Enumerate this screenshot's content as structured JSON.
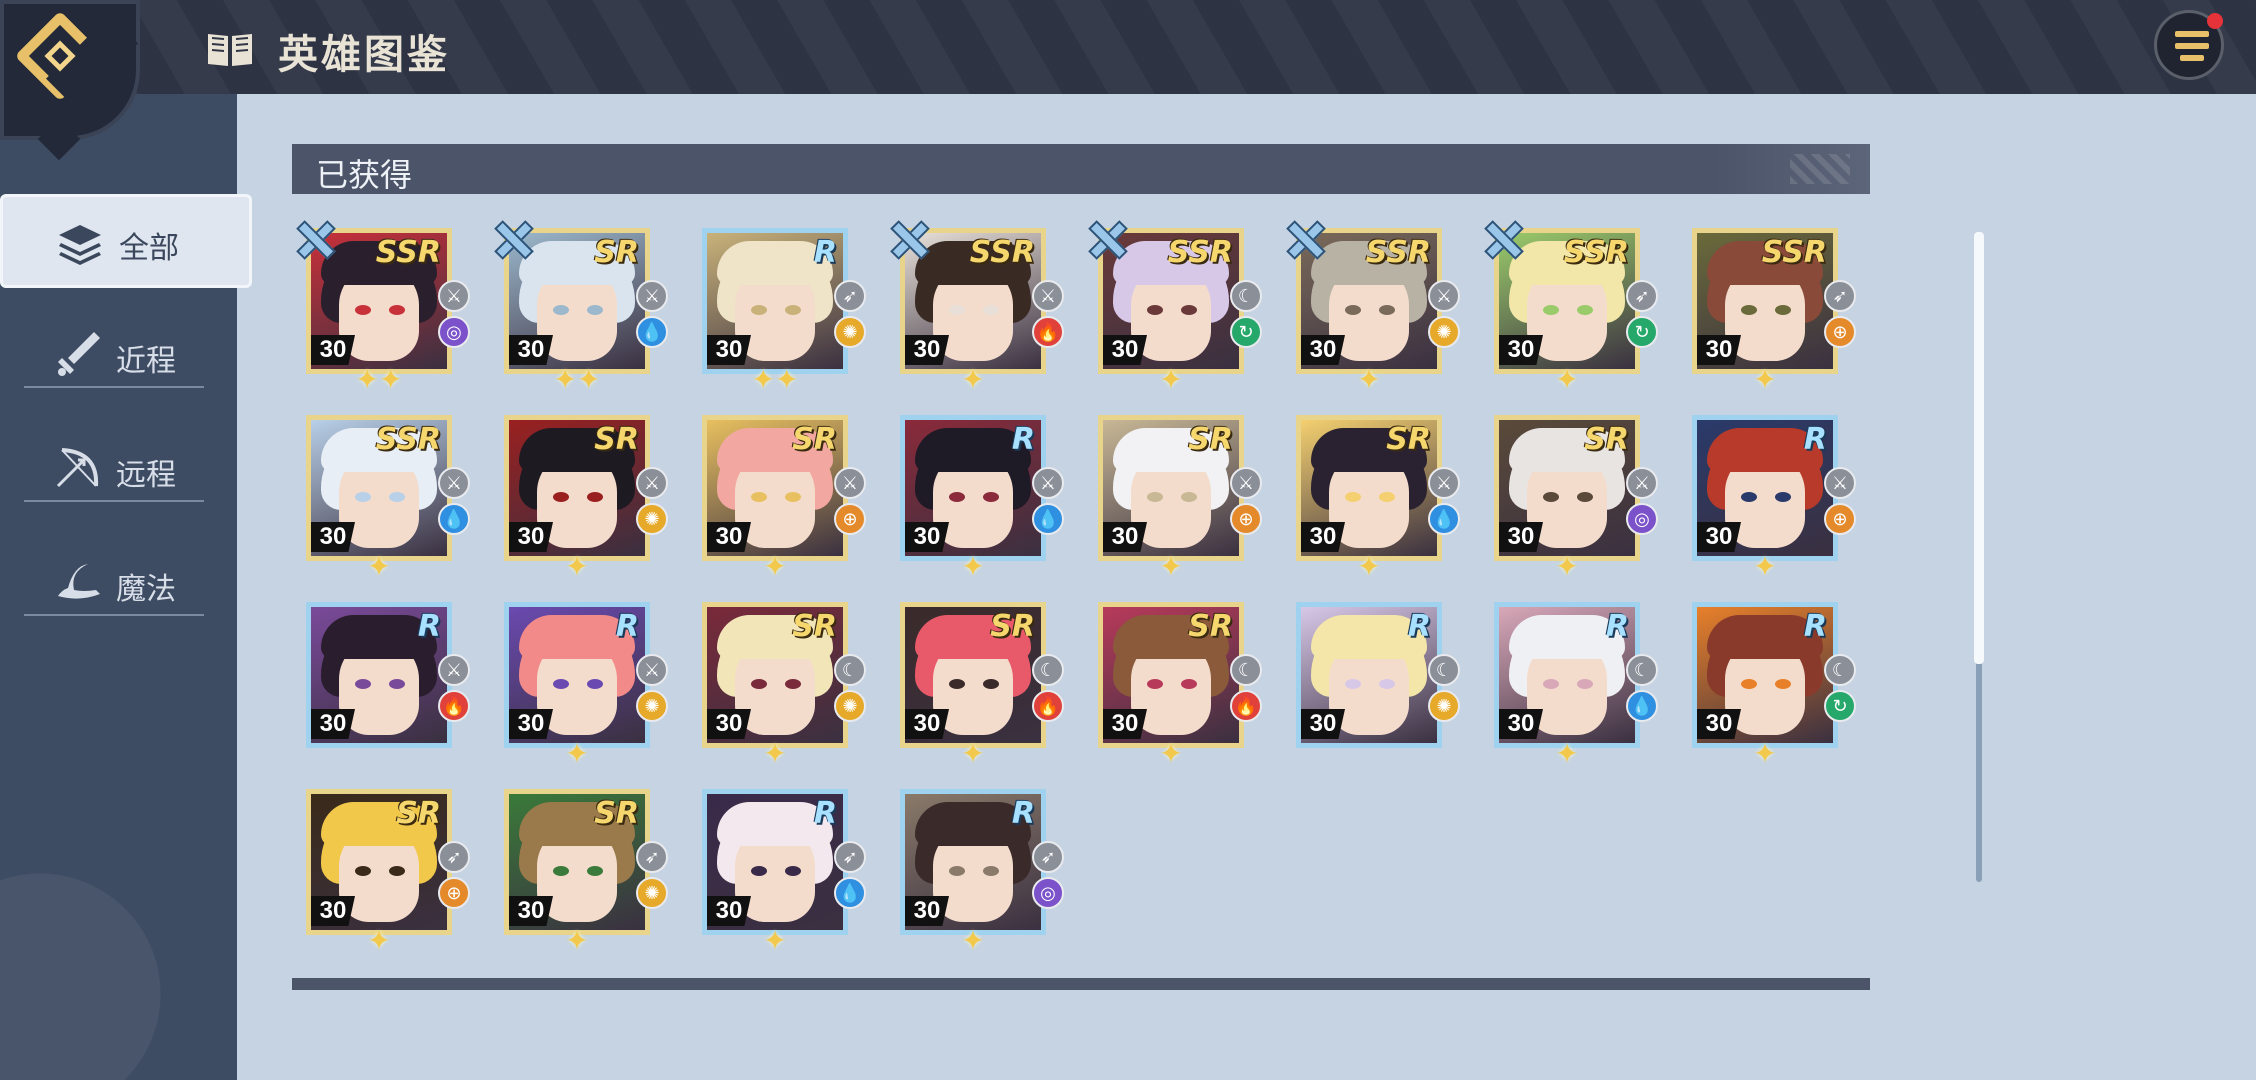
{
  "header": {
    "title": "英雄图鉴"
  },
  "sidebar": {
    "items": [
      {
        "label": "全部",
        "icon": "layers-icon",
        "active": true
      },
      {
        "label": "近程",
        "icon": "sword-icon",
        "active": false
      },
      {
        "label": "远程",
        "icon": "bow-icon",
        "active": false
      },
      {
        "label": "魔法",
        "icon": "witch-hat-icon",
        "active": false
      }
    ]
  },
  "sections": [
    {
      "label": "已获得"
    }
  ],
  "heroes": [
    {
      "rarity": "SSR",
      "level": "30",
      "cls": "melee",
      "elem": "dark",
      "stars": "✦✦",
      "equip": true
    },
    {
      "rarity": "SR",
      "level": "30",
      "cls": "melee",
      "elem": "water",
      "stars": "✦✦",
      "equip": true
    },
    {
      "rarity": "R",
      "level": "30",
      "cls": "ranged",
      "elem": "light",
      "stars": "✦✦",
      "equip": false
    },
    {
      "rarity": "SSR",
      "level": "30",
      "cls": "melee",
      "elem": "fire",
      "stars": "✦",
      "equip": true
    },
    {
      "rarity": "SSR",
      "level": "30",
      "cls": "magic",
      "elem": "wind",
      "stars": "✦",
      "equip": true
    },
    {
      "rarity": "SSR",
      "level": "30",
      "cls": "melee",
      "elem": "light",
      "stars": "✦",
      "equip": true
    },
    {
      "rarity": "SSR",
      "level": "30",
      "cls": "ranged",
      "elem": "wind",
      "stars": "✦",
      "equip": true
    },
    {
      "rarity": "SSR",
      "level": "30",
      "cls": "ranged",
      "elem": "earth",
      "stars": "✦",
      "equip": false
    },
    {
      "rarity": "SSR",
      "level": "30",
      "cls": "melee",
      "elem": "water",
      "stars": "✦",
      "equip": false
    },
    {
      "rarity": "SR",
      "level": "30",
      "cls": "melee",
      "elem": "light",
      "stars": "✦",
      "equip": false
    },
    {
      "rarity": "SR",
      "level": "30",
      "cls": "melee",
      "elem": "earth",
      "stars": "✦",
      "equip": false
    },
    {
      "rarity": "R",
      "level": "30",
      "cls": "melee",
      "elem": "water",
      "stars": "✦",
      "equip": false
    },
    {
      "rarity": "SR",
      "level": "30",
      "cls": "melee",
      "elem": "earth",
      "stars": "✦",
      "equip": false
    },
    {
      "rarity": "SR",
      "level": "30",
      "cls": "melee",
      "elem": "water",
      "stars": "✦",
      "equip": false
    },
    {
      "rarity": "SR",
      "level": "30",
      "cls": "melee",
      "elem": "dark",
      "stars": "✦",
      "equip": false
    },
    {
      "rarity": "R",
      "level": "30",
      "cls": "melee",
      "elem": "earth",
      "stars": "✦",
      "equip": false
    },
    {
      "rarity": "R",
      "level": "30",
      "cls": "melee",
      "elem": "fire",
      "stars": "",
      "equip": false
    },
    {
      "rarity": "R",
      "level": "30",
      "cls": "melee",
      "elem": "light",
      "stars": "✦",
      "equip": false
    },
    {
      "rarity": "SR",
      "level": "30",
      "cls": "magic",
      "elem": "light",
      "stars": "✦",
      "equip": false
    },
    {
      "rarity": "SR",
      "level": "30",
      "cls": "magic",
      "elem": "fire",
      "stars": "✦",
      "equip": false
    },
    {
      "rarity": "SR",
      "level": "30",
      "cls": "magic",
      "elem": "fire",
      "stars": "✦",
      "equip": false
    },
    {
      "rarity": "R",
      "level": "30",
      "cls": "magic",
      "elem": "light",
      "stars": "",
      "equip": false
    },
    {
      "rarity": "R",
      "level": "30",
      "cls": "magic",
      "elem": "water",
      "stars": "✦",
      "equip": false
    },
    {
      "rarity": "R",
      "level": "30",
      "cls": "magic",
      "elem": "wind",
      "stars": "✦",
      "equip": false
    },
    {
      "rarity": "SR",
      "level": "30",
      "cls": "ranged",
      "elem": "earth",
      "stars": "✦",
      "equip": false
    },
    {
      "rarity": "SR",
      "level": "30",
      "cls": "ranged",
      "elem": "light",
      "stars": "✦",
      "equip": false
    },
    {
      "rarity": "R",
      "level": "30",
      "cls": "ranged",
      "elem": "water",
      "stars": "✦",
      "equip": false
    },
    {
      "rarity": "R",
      "level": "30",
      "cls": "ranged",
      "elem": "dark",
      "stars": "✦",
      "equip": false
    }
  ],
  "element_colors": {
    "dark": "#7b52c9",
    "water": "#2f8fe0",
    "light": "#e6a92a",
    "fire": "#e0413a",
    "wind": "#26a86a",
    "earth": "#e48a2a"
  },
  "class_glyphs": {
    "melee": "⚔",
    "ranged": "➶",
    "magic": "☾"
  },
  "element_glyphs": {
    "dark": "◎",
    "water": "💧",
    "light": "✺",
    "fire": "🔥",
    "wind": "↻",
    "earth": "⊕"
  },
  "palettes": [
    [
      "#2a1f2c",
      "#c8303a"
    ],
    [
      "#d9e4ef",
      "#9cb8cc"
    ],
    [
      "#efe4c8",
      "#c9b27a"
    ],
    [
      "#3a2a24",
      "#e8e0d8"
    ],
    [
      "#d8c8e8",
      "#6a3a3a"
    ],
    [
      "#b8b2a4",
      "#7a6a5a"
    ],
    [
      "#f2e6a8",
      "#9acb6a"
    ],
    [
      "#8a4a3a",
      "#6a6a3a"
    ],
    [
      "#e8eef6",
      "#b8d0e8"
    ],
    [
      "#1e1a22",
      "#9a2020"
    ],
    [
      "#f2a8a0",
      "#e8c060"
    ],
    [
      "#1e1a26",
      "#8a2a3a"
    ],
    [
      "#f2f2f4",
      "#c8b896"
    ],
    [
      "#2a2230",
      "#f4d070"
    ],
    [
      "#e8e4e2",
      "#5a4a3a"
    ],
    [
      "#b83a2a",
      "#2a3a6a"
    ],
    [
      "#2a1e2e",
      "#7a4a9a"
    ],
    [
      "#f28a8a",
      "#6a4ab0"
    ],
    [
      "#f2e6b8",
      "#7a2a3a"
    ],
    [
      "#e85a6a",
      "#3a2a2a"
    ],
    [
      "#8a5a3a",
      "#b83a5a"
    ],
    [
      "#f4e6a8",
      "#d8c8e8"
    ],
    [
      "#eef0f4",
      "#d8a8b8"
    ],
    [
      "#8a3a2a",
      "#e8802a"
    ],
    [
      "#f2c84a",
      "#3a2a1a"
    ],
    [
      "#9a7a4a",
      "#3a7a3a"
    ],
    [
      "#f2e8ee",
      "#3a2a4a"
    ],
    [
      "#3a2a2a",
      "#8a7a6a"
    ]
  ]
}
